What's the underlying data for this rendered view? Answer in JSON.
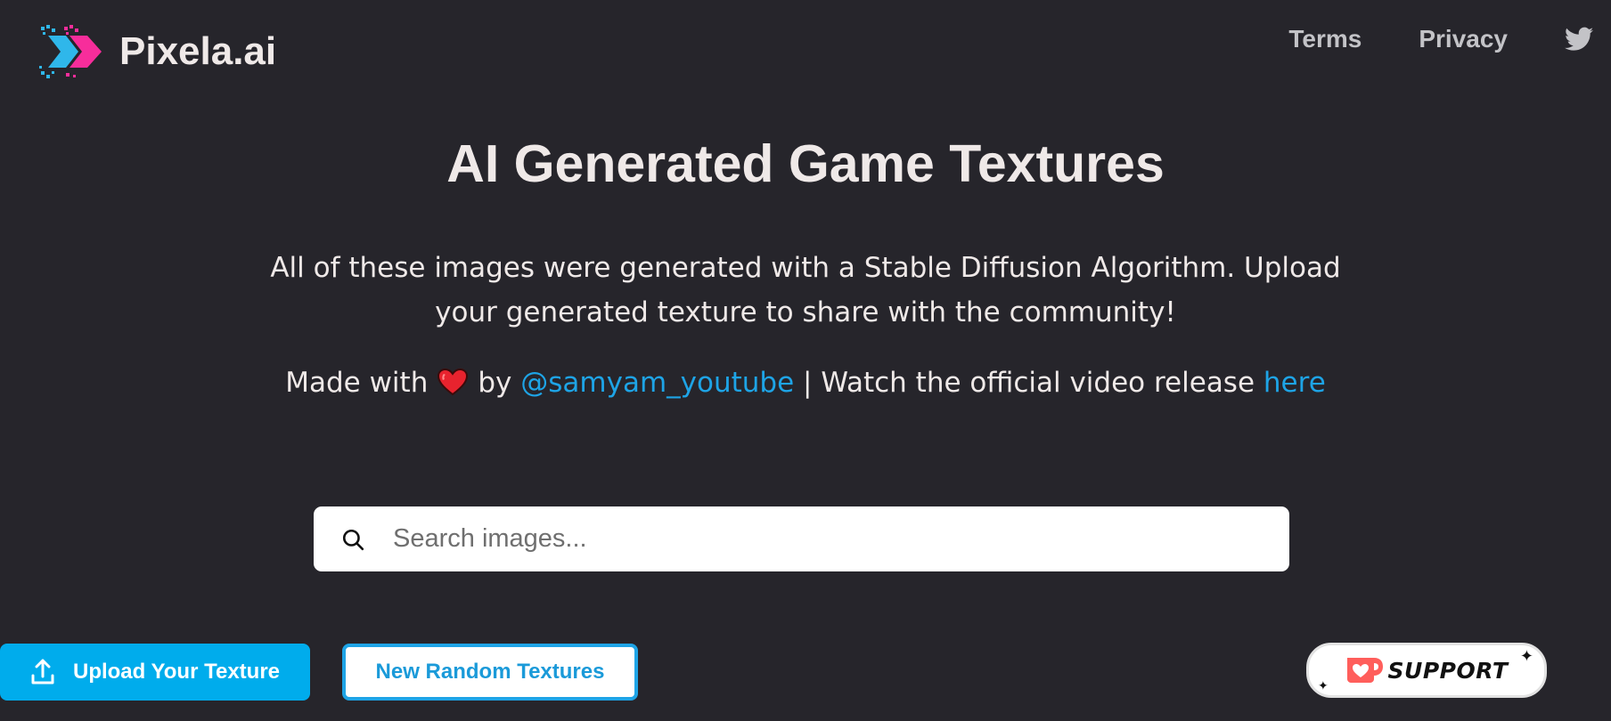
{
  "nav": {
    "logo_text": "Pixela.ai",
    "links": [
      {
        "label": "Terms"
      },
      {
        "label": "Privacy"
      }
    ],
    "social_icon": "twitter-icon"
  },
  "hero": {
    "title": "AI Generated Game Textures",
    "description_line1": "All of these images were generated with a Stable Diffusion Algorithm. Upload",
    "description_line2": "your generated texture to share with the community!",
    "made_with_prefix": "Made with",
    "made_with_icon": "heart-icon",
    "made_with_by": "by",
    "author_link": "@samyam_youtube",
    "separator_text": "| Watch the official video release",
    "here_link": "here"
  },
  "search": {
    "placeholder": "Search images...",
    "value": ""
  },
  "actions": {
    "upload_label": "Upload Your Texture",
    "random_label": "New Random Textures"
  },
  "support": {
    "label": "SUPPORT"
  },
  "colors": {
    "background": "#26252b",
    "text": "#efe9e8",
    "accent_blue": "#00acec",
    "link_blue": "#1ea4e6",
    "logo_pink": "#f72d9b",
    "heart_red": "#e8232e",
    "kofi_red": "#ff5e5b"
  }
}
